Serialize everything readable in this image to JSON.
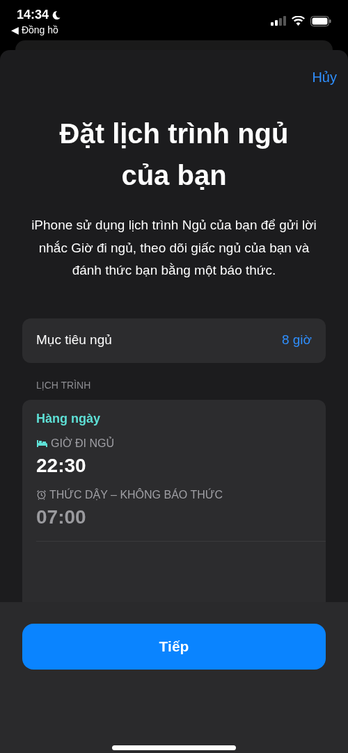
{
  "status_bar": {
    "time": "14:34",
    "focus_moon": true,
    "back_label": "◀ Đồng hồ"
  },
  "sheet": {
    "cancel": "Hủy",
    "title": "Đặt lịch trình ngủ của bạn",
    "description": "iPhone sử dụng lịch trình Ngủ của bạn để gửi lời nhắc Giờ đi ngủ, theo dõi giấc ngủ của bạn và đánh thức bạn bằng một báo thức."
  },
  "sleep_goal": {
    "label": "Mục tiêu ngủ",
    "value": "8 giờ"
  },
  "schedule": {
    "section_title": "LỊCH TRÌNH",
    "days": "Hàng ngày",
    "entries": [
      {
        "kind": "bedtime",
        "label": "GIỜ ĐI NGỦ",
        "time": "22:30",
        "disabled": false
      },
      {
        "kind": "wake",
        "label": "THỨC DẬY – KHÔNG BÁO THỨC",
        "time": "07:00",
        "disabled": true
      }
    ]
  },
  "footer": {
    "button": "Tiếp"
  }
}
